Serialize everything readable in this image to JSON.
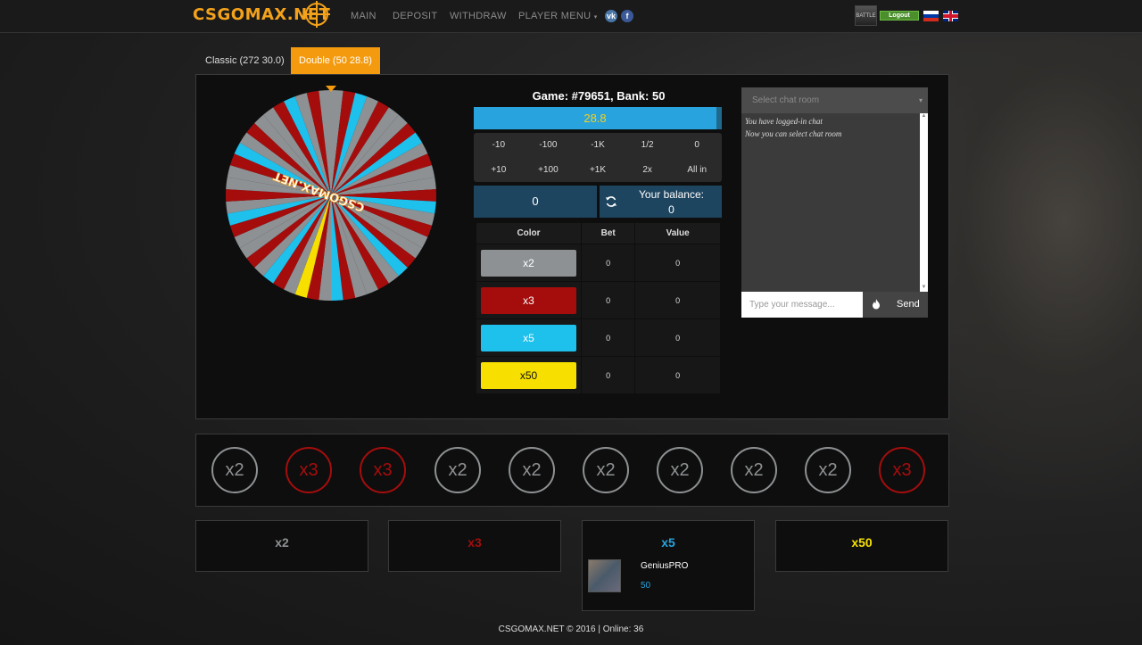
{
  "header": {
    "logo": "CSGOMAX.NET",
    "nav": [
      "MAIN",
      "DEPOSIT",
      "WITHDRAW",
      "PLAYER MENU"
    ],
    "social": [
      "vk",
      "f"
    ],
    "logout_label": "Logout"
  },
  "tabs": [
    {
      "label": "Classic (272 30.0)",
      "active": false
    },
    {
      "label": "Double (50 28.8)",
      "active": true
    }
  ],
  "game": {
    "title": "Game: #79651, Bank: 50",
    "progress_value": "28.8",
    "amount_buttons": [
      "-10",
      "-100",
      "-1K",
      "1/2",
      "0",
      "+10",
      "+100",
      "+1K",
      "2x",
      "All in"
    ],
    "bet_amount": "0",
    "balance_label": "Your balance:",
    "balance_value": "0",
    "table_headers": [
      "Color",
      "Bet",
      "Value"
    ],
    "rows": [
      {
        "label": "x2",
        "color": "#8e9193",
        "bet": "0",
        "value": "0"
      },
      {
        "label": "x3",
        "color": "#a50d0d",
        "bet": "0",
        "value": "0"
      },
      {
        "label": "x5",
        "color": "#1ec0ec",
        "bet": "0",
        "value": "0"
      },
      {
        "label": "x50",
        "color": "#f7e000",
        "bet": "0",
        "value": "0"
      }
    ]
  },
  "wheel": {
    "center_text": "CSGOMAX.NET",
    "colors": {
      "gray": "#8e9193",
      "red": "#a50d0d",
      "blue": "#1ec0ec",
      "yellow": "#f7e000"
    }
  },
  "chat": {
    "select_placeholder": "Select chat room",
    "messages": [
      "You have logged-in chat",
      "Now you can select chat room"
    ],
    "input_placeholder": "Type your message...",
    "send_label": "Send"
  },
  "history": [
    {
      "label": "x2",
      "color": "#8e9193"
    },
    {
      "label": "x3",
      "color": "#a50d0d"
    },
    {
      "label": "x3",
      "color": "#a50d0d"
    },
    {
      "label": "x2",
      "color": "#8e9193"
    },
    {
      "label": "x2",
      "color": "#8e9193"
    },
    {
      "label": "x2",
      "color": "#8e9193"
    },
    {
      "label": "x2",
      "color": "#8e9193"
    },
    {
      "label": "x2",
      "color": "#8e9193"
    },
    {
      "label": "x2",
      "color": "#8e9193"
    },
    {
      "label": "x3",
      "color": "#a50d0d"
    }
  ],
  "color_panels": [
    {
      "label": "x2",
      "color": "#8e9193"
    },
    {
      "label": "x3",
      "color": "#a50d0d"
    },
    {
      "label": "x5",
      "color": "#29a3dd",
      "player": {
        "name": "GeniusPRO",
        "amount": "50"
      }
    },
    {
      "label": "x50",
      "color": "#f7e000"
    }
  ],
  "footer": "CSGOMAX.NET © 2016 | Online: 36"
}
